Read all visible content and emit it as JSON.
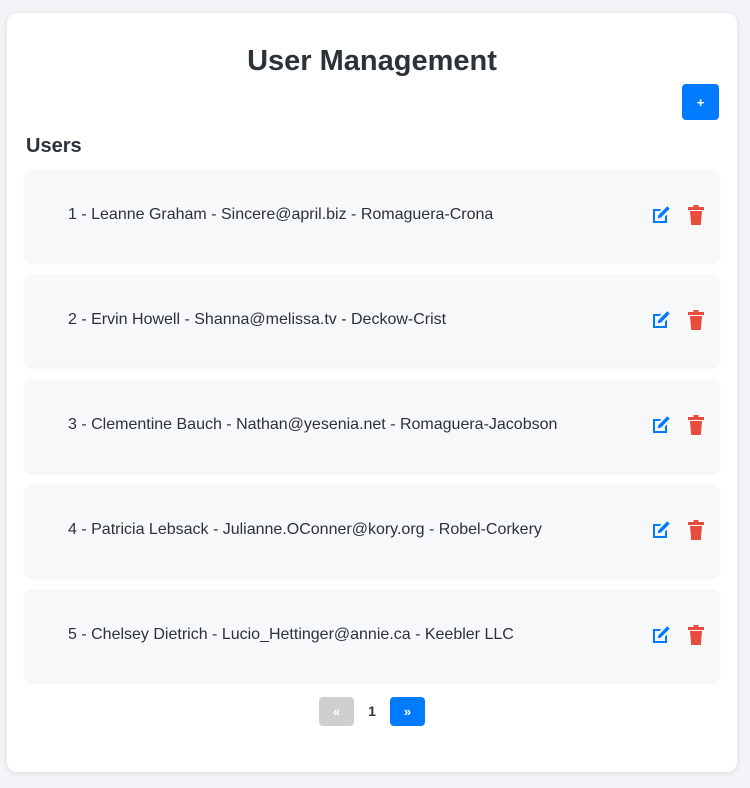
{
  "page": {
    "title": "User Management",
    "add_button_label": "+"
  },
  "users_section": {
    "heading": "Users",
    "rows": [
      {
        "text": "1 - Leanne Graham - Sincere@april.biz - Romaguera-Crona"
      },
      {
        "text": "2 - Ervin Howell - Shanna@melissa.tv - Deckow-Crist"
      },
      {
        "text": "3 - Clementine Bauch - Nathan@yesenia.net - Romaguera-Jacobson"
      },
      {
        "text": "4 - Patricia Lebsack - Julianne.OConner@kory.org - Robel-Corkery"
      },
      {
        "text": "5 - Chelsey Dietrich - Lucio_Hettinger@annie.ca - Keebler LLC"
      }
    ],
    "row_icons": {
      "edit": "edit-icon",
      "delete": "trash-icon"
    }
  },
  "pagination": {
    "prev_label": "«",
    "current_page": "1",
    "next_label": "»"
  },
  "colors": {
    "primary": "#007bff",
    "danger": "#e74c3c",
    "disabled": "#cfcfcf",
    "text": "#2b3338"
  }
}
